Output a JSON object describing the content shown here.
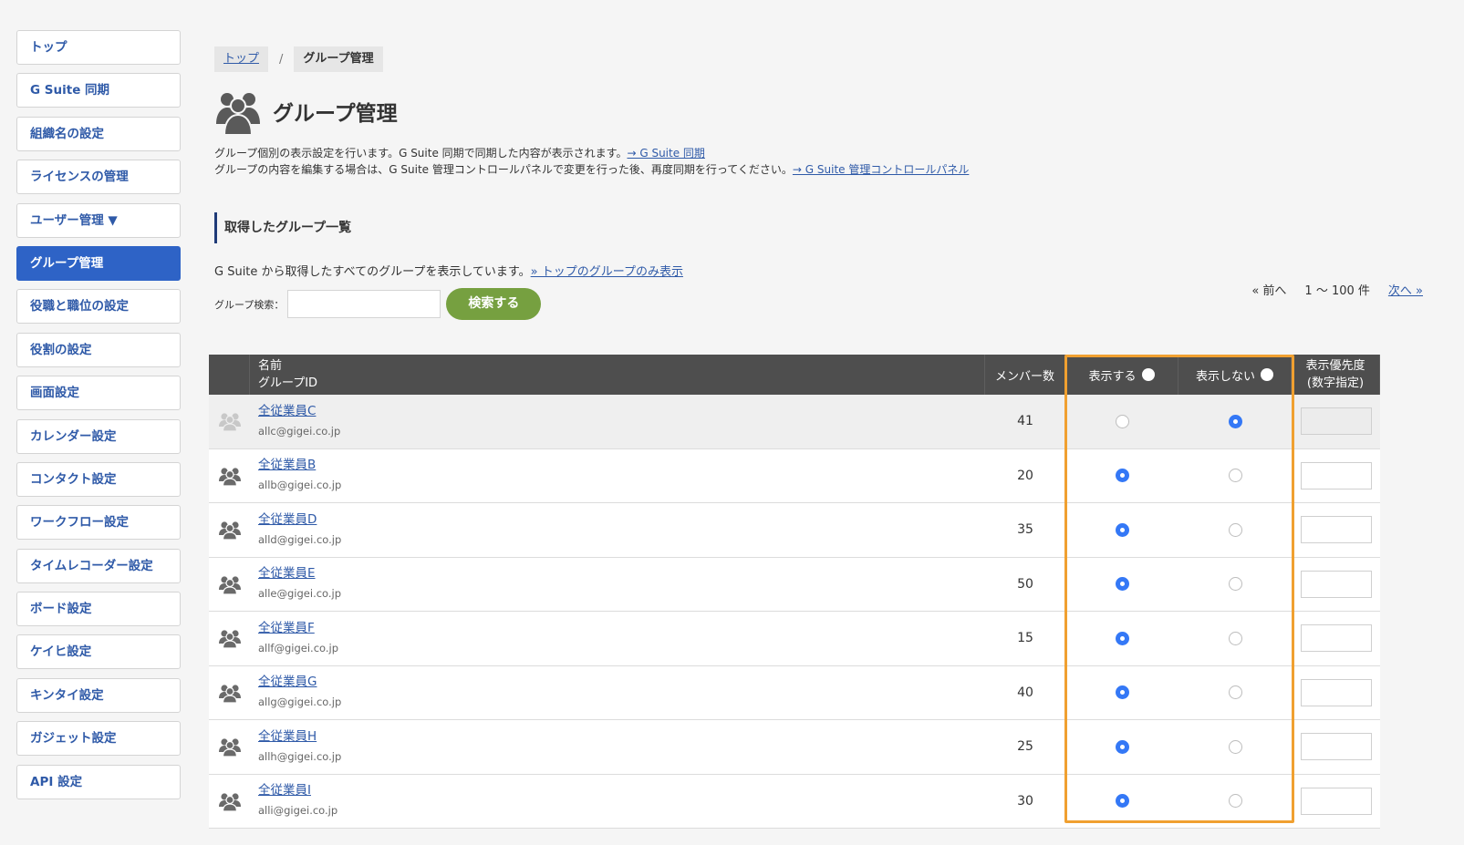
{
  "sidebar": {
    "items": [
      {
        "label": "トップ",
        "active": false
      },
      {
        "label": "G Suite 同期",
        "active": false
      },
      {
        "label": "組織名の設定",
        "active": false
      },
      {
        "label": "ライセンスの管理",
        "active": false
      },
      {
        "label": "ユーザー管理 ▼",
        "active": false
      },
      {
        "label": "グループ管理",
        "active": true
      },
      {
        "label": "役職と職位の設定",
        "active": false
      },
      {
        "label": "役割の設定",
        "active": false
      },
      {
        "label": "画面設定",
        "active": false
      },
      {
        "label": "カレンダー設定",
        "active": false
      },
      {
        "label": "コンタクト設定",
        "active": false
      },
      {
        "label": "ワークフロー設定",
        "active": false
      },
      {
        "label": "タイムレコーダー設定",
        "active": false
      },
      {
        "label": "ボード設定",
        "active": false
      },
      {
        "label": "ケイヒ設定",
        "active": false
      },
      {
        "label": "キンタイ設定",
        "active": false
      },
      {
        "label": "ガジェット設定",
        "active": false
      },
      {
        "label": "API 設定",
        "active": false
      }
    ]
  },
  "breadcrumb": {
    "home": "トップ",
    "separator": "/",
    "current": "グループ管理"
  },
  "page": {
    "title": "グループ管理",
    "title_icon": "group-icon",
    "desc_line1": "グループ個別の表示設定を行います。G Suite 同期で同期した内容が表示されます。",
    "desc_link1": "→ G Suite 同期",
    "desc_line2": "グループの内容を編集する場合は、G Suite 管理コントロールパネルで変更を行った後、再度同期を行ってください。",
    "desc_link2": "→ G Suite 管理コントロールパネル"
  },
  "section": {
    "title": "取得したグループ一覧",
    "note": "G Suite から取得したすべてのグループを表示しています。",
    "note_link": "» トップのグループのみ表示"
  },
  "search": {
    "label": "グループ検索：",
    "value": "",
    "button": "検索する"
  },
  "pager": {
    "prev": "« 前へ",
    "range": "1 〜 100 件",
    "next": "次へ »"
  },
  "table": {
    "headers": {
      "name": "名前",
      "group_id": "グループID",
      "members": "メンバー数",
      "show": "表示する",
      "hide": "表示しない",
      "priority_line1": "表示優先度",
      "priority_line2": "(数字指定)"
    },
    "rows": [
      {
        "name": "全従業員C",
        "id": "allc@gigei.co.jp",
        "members": "41",
        "show": false,
        "priority": ""
      },
      {
        "name": "全従業員B",
        "id": "allb@gigei.co.jp",
        "members": "20",
        "show": true,
        "priority": ""
      },
      {
        "name": "全従業員D",
        "id": "alld@gigei.co.jp",
        "members": "35",
        "show": true,
        "priority": ""
      },
      {
        "name": "全従業員E",
        "id": "alle@gigei.co.jp",
        "members": "50",
        "show": true,
        "priority": ""
      },
      {
        "name": "全従業員F",
        "id": "allf@gigei.co.jp",
        "members": "15",
        "show": true,
        "priority": ""
      },
      {
        "name": "全従業員G",
        "id": "allg@gigei.co.jp",
        "members": "40",
        "show": true,
        "priority": ""
      },
      {
        "name": "全従業員H",
        "id": "allh@gigei.co.jp",
        "members": "25",
        "show": true,
        "priority": ""
      },
      {
        "name": "全従業員I",
        "id": "alli@gigei.co.jp",
        "members": "30",
        "show": true,
        "priority": ""
      }
    ]
  },
  "colors": {
    "accent": "#2e63c6",
    "link": "#2f5aa8",
    "search_button": "#76a040",
    "table_header": "#4e4e4e",
    "radio_selected": "#3478f6",
    "highlight_border": "#f0a030"
  }
}
